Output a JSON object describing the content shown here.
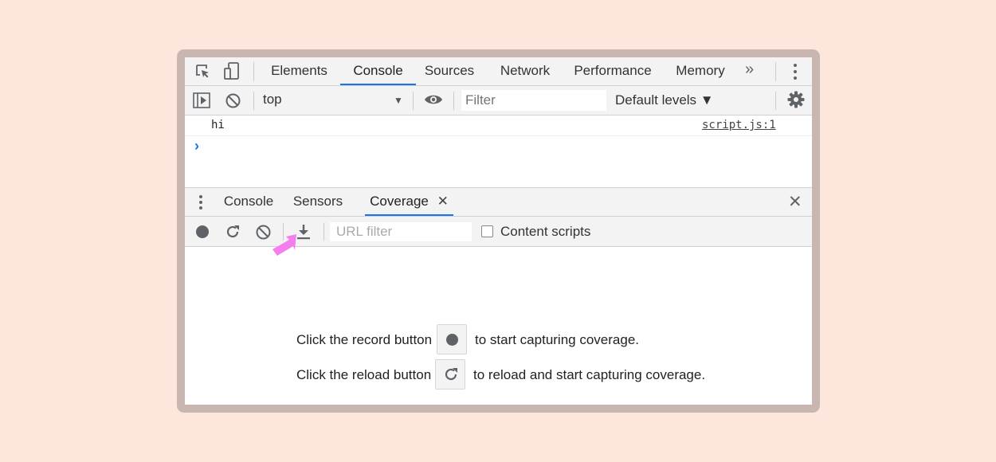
{
  "top_tabs": [
    {
      "label": "Elements",
      "active": false
    },
    {
      "label": "Console",
      "active": true
    },
    {
      "label": "Sources",
      "active": false
    },
    {
      "label": "Network",
      "active": false
    },
    {
      "label": "Performance",
      "active": false
    },
    {
      "label": "Memory",
      "active": false
    }
  ],
  "top_overflow": "»",
  "console_toolbar": {
    "context": "top",
    "filter_placeholder": "Filter",
    "levels": "Default levels ▼"
  },
  "console": {
    "messages": [
      {
        "text": "hi",
        "source": "script.js:1"
      }
    ],
    "prompt": "›"
  },
  "drawer_tabs": [
    {
      "label": "Console",
      "active": false
    },
    {
      "label": "Sensors",
      "active": false
    },
    {
      "label": "Coverage",
      "active": true,
      "closable": true
    }
  ],
  "coverage": {
    "url_filter_placeholder": "URL filter",
    "content_scripts_label": "Content scripts",
    "record_pre": "Click the record button",
    "record_post": "to start capturing coverage.",
    "reload_pre": "Click the reload button",
    "reload_post": "to reload and start capturing coverage."
  },
  "colors": {
    "accent": "#1a73e8",
    "annotation_arrow": "#f47ef0",
    "icon": "#5f6368"
  }
}
